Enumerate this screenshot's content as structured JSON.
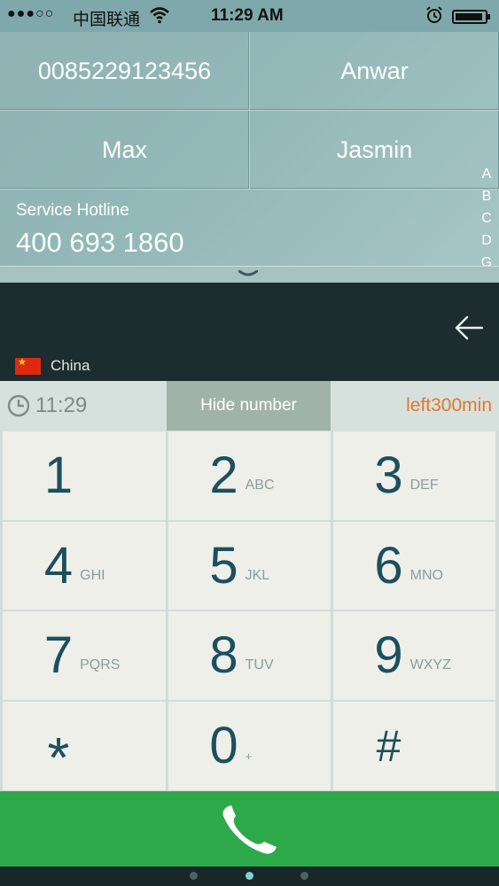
{
  "status_bar": {
    "signal": "●●●○○",
    "carrier": "中国联通",
    "time": "11:29 AM"
  },
  "contacts": [
    {
      "label": "0085229123456"
    },
    {
      "label": "Anwar"
    },
    {
      "label": "Max"
    },
    {
      "label": "Jasmin"
    }
  ],
  "hotline": {
    "label": "Service Hotline",
    "number": "400 693 1860"
  },
  "alpha_index": [
    "A",
    "B",
    "C",
    "D",
    "G"
  ],
  "country": {
    "name": "China",
    "flag_color": "#de2910"
  },
  "info_bar": {
    "timer": "11:29",
    "hide_number": "Hide number",
    "minutes_left": "left300min"
  },
  "keypad": [
    {
      "digit": "1",
      "letters": ""
    },
    {
      "digit": "2",
      "letters": "ABC"
    },
    {
      "digit": "3",
      "letters": "DEF"
    },
    {
      "digit": "4",
      "letters": "GHI"
    },
    {
      "digit": "5",
      "letters": "JKL"
    },
    {
      "digit": "6",
      "letters": "MNO"
    },
    {
      "digit": "7",
      "letters": "PQRS"
    },
    {
      "digit": "8",
      "letters": "TUV"
    },
    {
      "digit": "9",
      "letters": "WXYZ"
    },
    {
      "digit": "*",
      "letters": ""
    },
    {
      "digit": "0",
      "letters": "+"
    },
    {
      "digit": "#",
      "letters": ""
    }
  ],
  "colors": {
    "call_button": "#2ea94a",
    "digit": "#1d4f5e",
    "minutes_text": "#e0782e",
    "active_dot": "#7fd3d2"
  },
  "icons": {
    "call": "phone-handset-icon",
    "back": "arrow-left-icon",
    "timer": "clock-icon"
  }
}
